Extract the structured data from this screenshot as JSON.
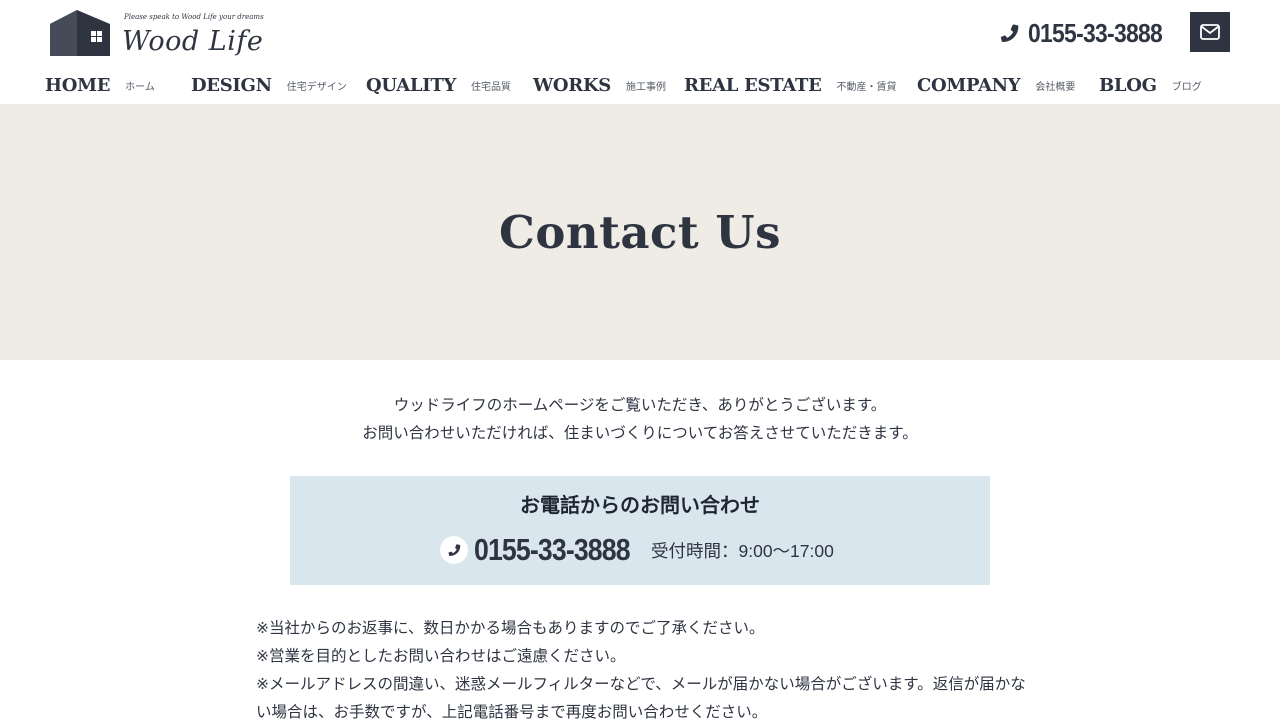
{
  "header": {
    "logo": {
      "tagline": "Please speak to Wood Life your dreams",
      "name": "Wood Life"
    },
    "phone": "0155-33-3888",
    "icons": {
      "phone": "phone-icon",
      "mail": "envelope-icon"
    }
  },
  "nav": [
    {
      "en": "HOME",
      "ja": "ホーム"
    },
    {
      "en": "DESIGN",
      "ja": "住宅デザイン"
    },
    {
      "en": "QUALITY",
      "ja": "住宅品質"
    },
    {
      "en": "WORKS",
      "ja": "施工事例"
    },
    {
      "en": "REAL ESTATE",
      "ja": "不動産・賃貸"
    },
    {
      "en": "COMPANY",
      "ja": "会社概要"
    },
    {
      "en": "BLOG",
      "ja": "ブログ"
    }
  ],
  "hero": {
    "title": "Contact Us"
  },
  "intro": [
    "ウッドライフのホームページをご覧いただき、ありがとうございます。",
    "お問い合わせいただければ、住まいづくりについてお答えさせていただきます。"
  ],
  "phone_box": {
    "title": "お電話からのお問い合わせ",
    "number": "0155-33-3888",
    "hours": "受付時間：9:00〜17:00"
  },
  "notes": [
    "※当社からのお返事に、数日かかる場合もありますのでご了承ください。",
    "※営業を目的としたお問い合わせはご遠慮ください。",
    "※メールアドレスの間違い、迷惑メールフィルターなどで、メールが届かない場合がございます。返信が届かない場合は、お手数ですが、上記電話番号まで再度お問い合わせください。"
  ],
  "colors": {
    "primary": "#2f3441",
    "hero_bg": "#efebe5",
    "phone_box_bg": "#d9e6ed"
  }
}
